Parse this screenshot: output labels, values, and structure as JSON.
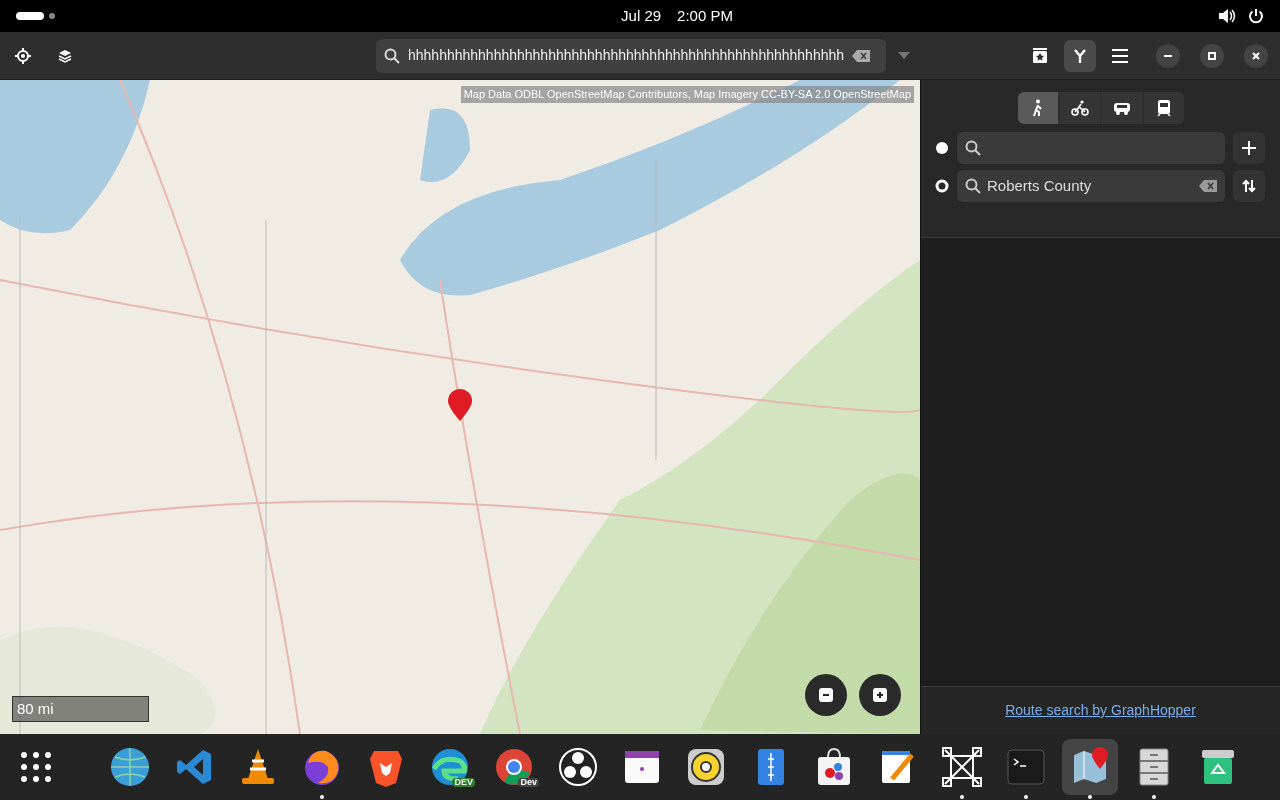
{
  "top_bar": {
    "date": "Jul 29",
    "time": "2:00 PM"
  },
  "header": {
    "search_value": "hhhhhhhhhhhhhhhhhhhhhhhhhhhhhhhhhhhhhhhhhhhhhhhhhhhhhhhh",
    "route_toggle_on": true
  },
  "map": {
    "attribution": "Map Data ODBL OpenStreetMap Contributors, Map Imagery CC-BY-SA 2.0 OpenStreetMap",
    "scale": "80 mi"
  },
  "route_panel": {
    "modes": [
      {
        "kind": "walk",
        "selected": true
      },
      {
        "kind": "bike",
        "selected": false
      },
      {
        "kind": "car",
        "selected": false
      },
      {
        "kind": "transit",
        "selected": false
      }
    ],
    "stops": [
      {
        "kind": "start"
      },
      {
        "kind": "end",
        "value": "Roberts County"
      }
    ],
    "credit": "Route search by GraphHopper"
  },
  "dock": [
    {
      "running": false,
      "selected": false
    },
    {
      "running": false,
      "selected": false
    },
    {
      "running": false,
      "selected": false
    },
    {
      "running": true,
      "selected": false
    },
    {
      "running": false,
      "selected": false
    },
    {
      "running": false,
      "selected": false,
      "badge": "DEV"
    },
    {
      "running": false,
      "selected": false,
      "badge": "Dev"
    },
    {
      "running": false,
      "selected": false
    },
    {
      "running": false,
      "selected": false
    },
    {
      "running": false,
      "selected": false
    },
    {
      "running": false,
      "selected": false
    },
    {
      "running": false,
      "selected": false
    },
    {
      "running": false,
      "selected": false
    },
    {
      "running": true,
      "selected": false
    },
    {
      "running": true,
      "selected": false
    },
    {
      "running": true,
      "selected": true
    },
    {
      "running": true,
      "selected": false
    },
    {
      "running": false,
      "selected": false
    }
  ]
}
